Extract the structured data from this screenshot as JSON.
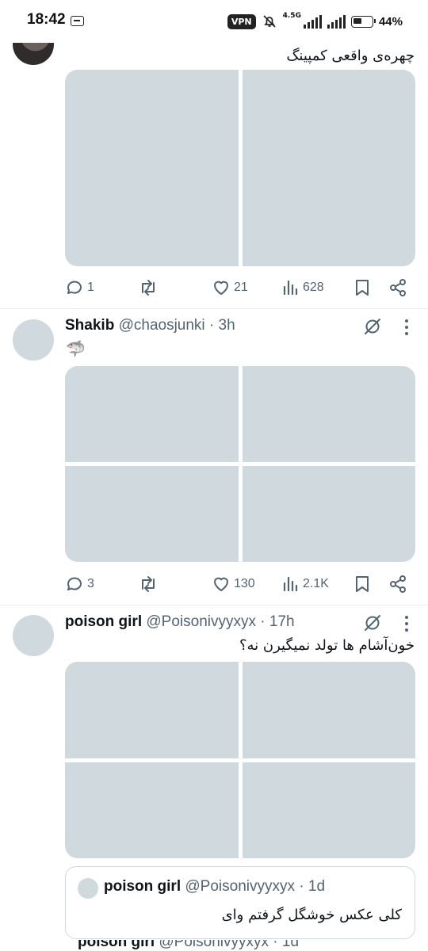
{
  "status_bar": {
    "time": "18:42",
    "vpn_label": "VPN",
    "network": "4.5G",
    "battery": "44%"
  },
  "tweets": [
    {
      "text": "چهره‌ی واقعی کمپینگ",
      "media_count": 2,
      "actions": {
        "replies": "1",
        "retweets": "",
        "likes": "21",
        "views": "628"
      }
    },
    {
      "name": "Shakib",
      "handle": "@chaosjunki",
      "time": "· 3h",
      "text": "🦈",
      "media_count": 4,
      "actions": {
        "replies": "3",
        "retweets": "",
        "likes": "130",
        "views": "2.1K"
      }
    },
    {
      "name": "poison girl",
      "handle": "@Poisonivyyxyx",
      "time": "· 17h",
      "text": "خون‌آشام ها تولد نمیگیرن نه؟",
      "media_count": 4,
      "quote": {
        "name": "poison girl",
        "handle": "@Poisonivyyxyx",
        "time": "· 1d",
        "text": "کلی عکس خوشگل گرفتم وای"
      }
    }
  ],
  "peek": {
    "name": "poison girl",
    "handle": "@Poisonivyyxyx",
    "time": "· 1d"
  },
  "colors": {
    "secondary_text": "#536471",
    "media_placeholder": "#cfd9de",
    "divider": "#e6ecf0"
  }
}
